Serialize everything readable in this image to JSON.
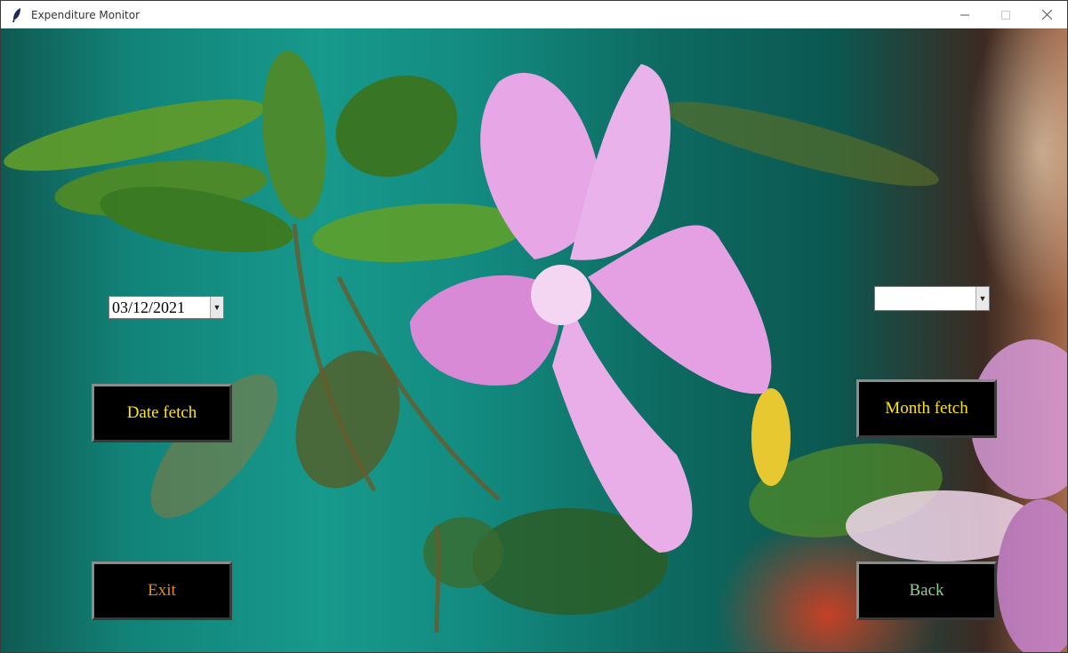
{
  "window": {
    "title": "Expenditure Monitor",
    "icon": "feather-icon"
  },
  "date_picker": {
    "value": "03/12/2021"
  },
  "month_picker": {
    "value": ""
  },
  "buttons": {
    "date_fetch": {
      "label": "Date fetch",
      "color": "#ffe600"
    },
    "month_fetch": {
      "label": "Month fetch",
      "color": "#ffe600"
    },
    "exit": {
      "label": "Exit",
      "color": "#e88a2a"
    },
    "back": {
      "label": "Back",
      "color": "#8fd08f"
    }
  },
  "background": {
    "image": "pink flower on teal background"
  }
}
